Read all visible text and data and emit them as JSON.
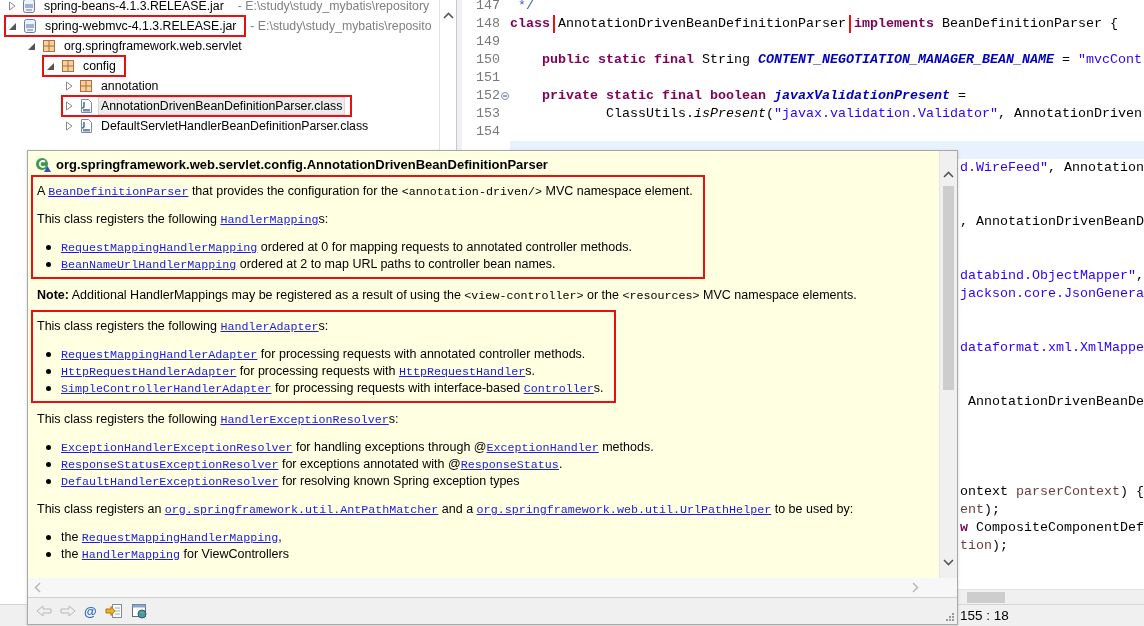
{
  "project_explorer": {
    "items": [
      {
        "kind": "jar",
        "label": "spring-beans-4.1.3.RELEASE.jar",
        "path": "- E:\\study\\study_mybatis\\repository",
        "expanded": false,
        "selected": false,
        "highlighted": false
      },
      {
        "kind": "jar",
        "label": "spring-webmvc-4.1.3.RELEASE.jar",
        "path": "- E:\\study\\study_mybatis\\reposito",
        "expanded": true,
        "selected": false,
        "highlighted": true,
        "children": [
          {
            "kind": "package",
            "label": "org.springframework.web.servlet",
            "expanded": true,
            "selected": false,
            "highlighted": false,
            "children": [
              {
                "kind": "package",
                "label": "config",
                "expanded": true,
                "selected": false,
                "highlighted": true,
                "children": [
                  {
                    "kind": "package",
                    "label": "annotation",
                    "expanded": false,
                    "selected": false,
                    "highlighted": false
                  },
                  {
                    "kind": "class",
                    "label": "AnnotationDrivenBeanDefinitionParser.class",
                    "expanded": false,
                    "selected": true,
                    "highlighted": true
                  },
                  {
                    "kind": "class",
                    "label": "DefaultServletHandlerBeanDefinitionParser.class",
                    "expanded": false,
                    "selected": false,
                    "highlighted": false
                  }
                ]
              }
            ]
          }
        ]
      }
    ]
  },
  "editor": {
    "lines": [
      {
        "number": "147",
        "foldable": false,
        "current": false,
        "segments": [
          {
            "kind": "comment",
            "text": " */",
            "highlighted": false
          }
        ]
      },
      {
        "number": "148",
        "foldable": false,
        "current": false,
        "segments": [
          {
            "kind": "keyword",
            "text": "class ",
            "highlighted": false
          },
          {
            "kind": "plain",
            "text": "AnnotationDrivenBeanDefinitionParser",
            "highlighted": true
          },
          {
            "kind": "keyword",
            "text": " implements",
            "highlighted": false
          },
          {
            "kind": "plain",
            "text": " BeanDefinitionParser {",
            "highlighted": false
          }
        ]
      },
      {
        "number": "149",
        "foldable": false,
        "current": false
      },
      {
        "number": "150",
        "foldable": false,
        "current": false,
        "segments": [
          {
            "kind": "keyword",
            "text": "    public static final",
            "highlighted": false
          },
          {
            "kind": "plain",
            "text": " String ",
            "highlighted": false
          },
          {
            "kind": "constant",
            "text": "CONTENT_NEGOTIATION_MANAGER_BEAN_NAME",
            "highlighted": false
          },
          {
            "kind": "plain",
            "text": " = ",
            "highlighted": false
          },
          {
            "kind": "string",
            "text": "\"mvcCont",
            "highlighted": false
          }
        ]
      },
      {
        "number": "151",
        "foldable": false,
        "current": false
      },
      {
        "number": "152",
        "foldable": true,
        "current": false,
        "segments": [
          {
            "kind": "keyword",
            "text": "    private static final boolean",
            "highlighted": false
          },
          {
            "kind": "constant",
            "text": " javaxValidationPresent",
            "highlighted": false
          },
          {
            "kind": "plain",
            "text": " =",
            "highlighted": false
          }
        ]
      },
      {
        "number": "153",
        "foldable": false,
        "current": false,
        "segments": [
          {
            "kind": "plain",
            "text": "            ClassUtils.",
            "highlighted": false
          },
          {
            "kind": "method",
            "text": "isPresent",
            "highlighted": false
          },
          {
            "kind": "plain",
            "text": "(",
            "highlighted": false
          },
          {
            "kind": "string",
            "text": "\"javax.validation.Validator\"",
            "highlighted": false
          },
          {
            "kind": "plain",
            "text": ", AnnotationDriven",
            "highlighted": false
          }
        ]
      },
      {
        "number": "154",
        "foldable": false,
        "current": false
      },
      {
        "foldable": false,
        "current": true
      }
    ],
    "covered_lines": [
      {
        "segments": [
          {
            "kind": "string",
            "text": "d.WireFeed\""
          },
          {
            "kind": "plain",
            "text": ", Annotation"
          }
        ]
      },
      {
        "segments": [
          {
            "kind": "plain",
            "text": ", AnnotationDrivenBeanD"
          }
        ]
      },
      {
        "segments": [
          {
            "kind": "string",
            "text": "databind.ObjectMapper\""
          },
          {
            "kind": "plain",
            "text": ","
          }
        ]
      },
      {
        "segments": [
          {
            "kind": "string",
            "text": "jackson.core.JsonGenera"
          }
        ]
      },
      {
        "segments": [
          {
            "kind": "string",
            "text": "dataformat.xml.XmlMappe"
          }
        ]
      },
      {
        "segments": [
          {
            "kind": "plain",
            "text": " AnnotationDrivenBeanDe"
          }
        ]
      },
      {
        "segments": [
          {
            "kind": "plain",
            "text": "ontext "
          },
          {
            "kind": "param",
            "text": "parserContext"
          },
          {
            "kind": "plain",
            "text": ") {"
          }
        ]
      },
      {
        "segments": [
          {
            "kind": "param",
            "text": "ent"
          },
          {
            "kind": "plain",
            "text": ");"
          }
        ]
      },
      {
        "segments": [
          {
            "kind": "keyword",
            "text": "w"
          },
          {
            "kind": "plain",
            "text": " CompositeComponentDef"
          }
        ]
      },
      {
        "segments": [
          {
            "kind": "param",
            "text": "tion"
          },
          {
            "kind": "plain",
            "text": ");"
          }
        ]
      }
    ]
  },
  "doc_popup": {
    "title": "org.springframework.web.servlet.config.AnnotationDrivenBeanDefinitionParser",
    "blocks": [
      {
        "highlighted": true,
        "items": [
          {
            "kind": "paragraph",
            "runs": [
              {
                "kind": "text",
                "text": "A "
              },
              {
                "kind": "link",
                "text": "BeanDefinitionParser"
              },
              {
                "kind": "text",
                "text": " that provides the configuration for the "
              },
              {
                "kind": "code",
                "text": "<annotation-driven/>"
              },
              {
                "kind": "text",
                "text": " MVC namespace element."
              }
            ]
          },
          {
            "kind": "paragraph",
            "runs": [
              {
                "kind": "text",
                "text": "This class registers the following "
              },
              {
                "kind": "link",
                "text": "HandlerMapping"
              },
              {
                "kind": "text",
                "text": "s:"
              }
            ]
          },
          {
            "kind": "list",
            "entries": [
              {
                "runs": [
                  {
                    "kind": "link",
                    "text": "RequestMappingHandlerMapping"
                  },
                  {
                    "kind": "text",
                    "text": " ordered at 0 for mapping requests to annotated controller methods."
                  }
                ]
              },
              {
                "runs": [
                  {
                    "kind": "link",
                    "text": "BeanNameUrlHandlerMapping"
                  },
                  {
                    "kind": "text",
                    "text": " ordered at 2 to map URL paths to controller bean names."
                  }
                ]
              }
            ]
          }
        ]
      },
      {
        "highlighted": false,
        "items": [
          {
            "kind": "paragraph",
            "runs": [
              {
                "kind": "bold",
                "text": "Note:"
              },
              {
                "kind": "text",
                "text": " Additional HandlerMappings may be registered as a result of using the "
              },
              {
                "kind": "code",
                "text": "<view-controller>"
              },
              {
                "kind": "text",
                "text": " or the "
              },
              {
                "kind": "code",
                "text": "<resources>"
              },
              {
                "kind": "text",
                "text": " MVC namespace elements."
              }
            ]
          }
        ]
      },
      {
        "highlighted": true,
        "items": [
          {
            "kind": "paragraph",
            "runs": [
              {
                "kind": "text",
                "text": "This class registers the following "
              },
              {
                "kind": "link",
                "text": "HandlerAdapter"
              },
              {
                "kind": "text",
                "text": "s:"
              }
            ]
          },
          {
            "kind": "list",
            "entries": [
              {
                "runs": [
                  {
                    "kind": "link",
                    "text": "RequestMappingHandlerAdapter"
                  },
                  {
                    "kind": "text",
                    "text": " for processing requests with annotated controller methods."
                  }
                ]
              },
              {
                "runs": [
                  {
                    "kind": "link",
                    "text": "HttpRequestHandlerAdapter"
                  },
                  {
                    "kind": "text",
                    "text": " for processing requests with "
                  },
                  {
                    "kind": "link",
                    "text": "HttpRequestHandler"
                  },
                  {
                    "kind": "text",
                    "text": "s."
                  }
                ]
              },
              {
                "runs": [
                  {
                    "kind": "link",
                    "text": "SimpleControllerHandlerAdapter"
                  },
                  {
                    "kind": "text",
                    "text": " for processing requests with interface-based "
                  },
                  {
                    "kind": "link",
                    "text": "Controller"
                  },
                  {
                    "kind": "text",
                    "text": "s."
                  }
                ]
              }
            ]
          }
        ]
      },
      {
        "highlighted": false,
        "items": [
          {
            "kind": "paragraph",
            "runs": [
              {
                "kind": "text",
                "text": "This class registers the following "
              },
              {
                "kind": "link",
                "text": "HandlerExceptionResolver"
              },
              {
                "kind": "text",
                "text": "s:"
              }
            ]
          },
          {
            "kind": "list",
            "entries": [
              {
                "runs": [
                  {
                    "kind": "link",
                    "text": "ExceptionHandlerExceptionResolver"
                  },
                  {
                    "kind": "text",
                    "text": " for handling exceptions through @"
                  },
                  {
                    "kind": "link",
                    "text": "ExceptionHandler"
                  },
                  {
                    "kind": "text",
                    "text": " methods."
                  }
                ]
              },
              {
                "runs": [
                  {
                    "kind": "link",
                    "text": "ResponseStatusExceptionResolver"
                  },
                  {
                    "kind": "text",
                    "text": " for exceptions annotated with @"
                  },
                  {
                    "kind": "link",
                    "text": "ResponseStatus"
                  },
                  {
                    "kind": "text",
                    "text": "."
                  }
                ]
              },
              {
                "runs": [
                  {
                    "kind": "link",
                    "text": "DefaultHandlerExceptionResolver"
                  },
                  {
                    "kind": "text",
                    "text": " for resolving known Spring exception types"
                  }
                ]
              }
            ]
          },
          {
            "kind": "paragraph",
            "runs": [
              {
                "kind": "text",
                "text": "This class registers an "
              },
              {
                "kind": "link",
                "text": "org.springframework.util.AntPathMatcher"
              },
              {
                "kind": "text",
                "text": " and a "
              },
              {
                "kind": "link",
                "text": "org.springframework.web.util.UrlPathHelper"
              },
              {
                "kind": "text",
                "text": " to be used by:"
              }
            ]
          },
          {
            "kind": "list",
            "entries": [
              {
                "runs": [
                  {
                    "kind": "text",
                    "text": "the "
                  },
                  {
                    "kind": "link",
                    "text": "RequestMappingHandlerMapping"
                  },
                  {
                    "kind": "text",
                    "text": ","
                  }
                ]
              },
              {
                "runs": [
                  {
                    "kind": "text",
                    "text": "the "
                  },
                  {
                    "kind": "link",
                    "text": "HandlerMapping"
                  },
                  {
                    "kind": "text",
                    "text": " for ViewControllers"
                  }
                ]
              }
            ]
          }
        ]
      }
    ],
    "toolbar": [
      {
        "kind": "back",
        "disabled": true
      },
      {
        "kind": "forward",
        "disabled": true
      },
      {
        "kind": "javadoc",
        "glyph": "@",
        "disabled": false
      },
      {
        "kind": "open-declaration",
        "disabled": false
      },
      {
        "kind": "open-external",
        "disabled": false
      }
    ]
  },
  "status_bar": {
    "position": "155 : 18"
  }
}
